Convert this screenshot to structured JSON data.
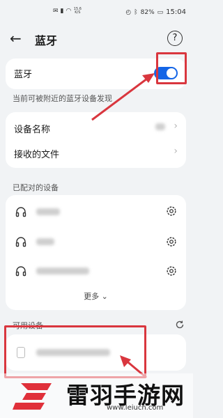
{
  "statusbar": {
    "net_speed_top": "15.6",
    "net_speed_bottom": "K/S",
    "battery": "82%",
    "time": "15:04"
  },
  "header": {
    "title": "蓝牙",
    "help_symbol": "?"
  },
  "bluetooth": {
    "label": "蓝牙",
    "enabled": true,
    "discoverable_hint": "当前可被附近的蓝牙设备发现"
  },
  "settings": {
    "device_name_label": "设备名称",
    "received_files_label": "接收的文件"
  },
  "paired": {
    "section_title": "已配对的设备",
    "more_label": "更多"
  },
  "available": {
    "section_title": "可用设备"
  },
  "watermark": {
    "brand": "雷羽手游网",
    "url": "www.leiucn.com"
  },
  "colors": {
    "accent": "#1465e6",
    "annotation": "#d9363e"
  }
}
